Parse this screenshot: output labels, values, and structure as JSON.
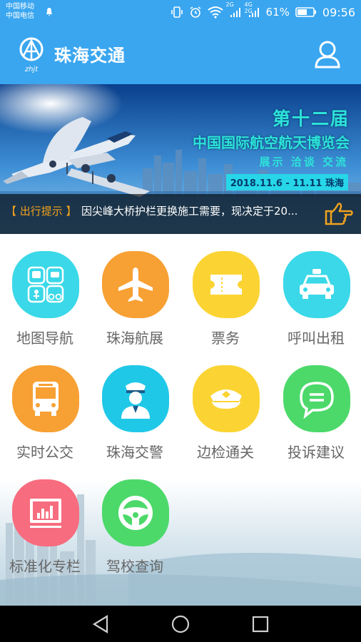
{
  "status_bar": {
    "carrier_1": "中国移动",
    "carrier_2": "中国电信",
    "network_badge_1": "2G",
    "network_badge_2": "4G",
    "network_badge_3": "2G",
    "battery": "61%",
    "time": "09:56"
  },
  "header": {
    "logo_text": "zhjt",
    "title": "珠海交通"
  },
  "banner": {
    "expo_title": "第十二届",
    "expo_subtitle": "中国国际航空航天博览会",
    "expo_tags": "展示 洽谈 交流",
    "expo_date": "2018.11.6 - 11.11 珠海",
    "notice_tag": "【 出行提示 】",
    "notice_text": "因尖峰大桥护栏更换施工需要，现决定于20..."
  },
  "services": [
    {
      "label": "地图导航",
      "color": "#3ad8e8",
      "icon": "map-navigation-icon"
    },
    {
      "label": "珠海航展",
      "color": "#f7a033",
      "icon": "airplane-icon"
    },
    {
      "label": "票务",
      "color": "#fbd434",
      "icon": "ticket-icon"
    },
    {
      "label": "呼叫出租",
      "color": "#3ad8e8",
      "icon": "taxi-icon"
    },
    {
      "label": "实时公交",
      "color": "#f7a033",
      "icon": "bus-icon"
    },
    {
      "label": "珠海交警",
      "color": "#20c8e8",
      "icon": "police-officer-icon"
    },
    {
      "label": "边检通关",
      "color": "#fbd434",
      "icon": "border-officer-cap-icon"
    },
    {
      "label": "投诉建议",
      "color": "#4cd96a",
      "icon": "chat-bubble-icon"
    },
    {
      "label": "标准化专栏",
      "color": "#f76c7e",
      "icon": "monitor-chart-icon"
    },
    {
      "label": "驾校查询",
      "color": "#4cd96a",
      "icon": "steering-wheel-icon"
    }
  ],
  "colors": {
    "header_blue": "#3aa6f0",
    "notice_orange": "#f0a21e"
  }
}
